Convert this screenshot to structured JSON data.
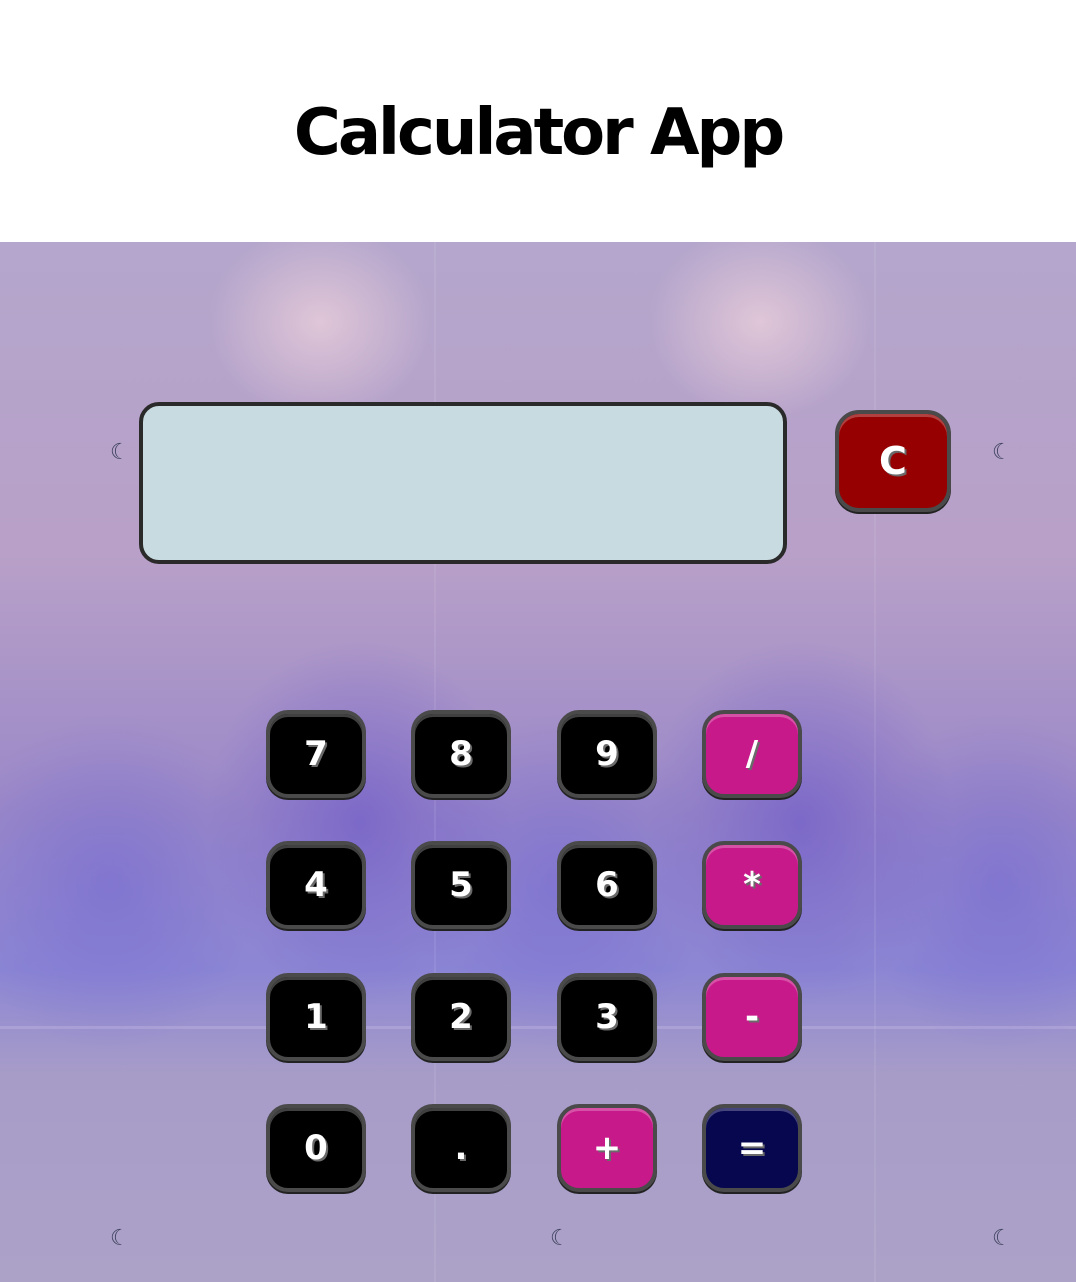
{
  "app": {
    "title": "Calculator App"
  },
  "display": {
    "value": ""
  },
  "buttons": {
    "clear": "C",
    "seven": "7",
    "eight": "8",
    "nine": "9",
    "divide": "/",
    "four": "4",
    "five": "5",
    "six": "6",
    "multiply": "*",
    "one": "1",
    "two": "2",
    "three": "3",
    "subtract": "-",
    "zero": "0",
    "decimal": ".",
    "add": "+",
    "equals": "="
  },
  "decorations": {
    "moon_glyph": "☾"
  },
  "colors": {
    "number_button": "#000000",
    "operator_button": "#c8198a",
    "equals_button": "#07074f",
    "clear_button": "#970000",
    "display_background": "#c7dbe1"
  }
}
